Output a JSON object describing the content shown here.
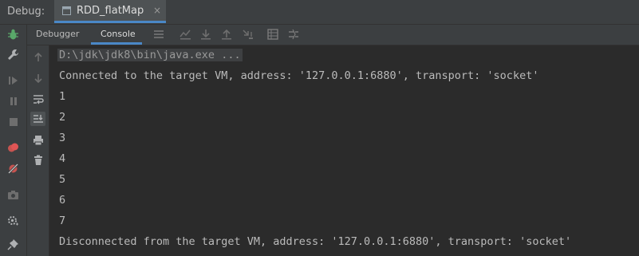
{
  "header": {
    "debug_label": "Debug:",
    "run_tab_label": "RDD_flatMap",
    "close_glyph": "×"
  },
  "toolbar": {
    "tabs": [
      "Debugger",
      "Console"
    ],
    "active_tab": "Console",
    "icons": [
      "menu-icon",
      "show-execution-point-icon",
      "step-over-icon",
      "step-into-icon",
      "step-out-icon",
      "run-to-cursor-icon",
      "evaluate-expression-icon",
      "trace-icon"
    ]
  },
  "left_toolbar": {
    "icons": [
      "debug-bug-icon",
      "wrench-icon",
      "resume-icon",
      "pause-icon",
      "stop-icon",
      "view-breakpoints-icon",
      "mute-breakpoints-icon",
      "camera-icon",
      "settings-icon",
      "pin-icon"
    ]
  },
  "console_sidebar": {
    "icons": [
      "up-arrow-icon",
      "down-arrow-icon",
      "soft-wrap-icon",
      "scroll-to-end-icon",
      "print-icon",
      "trash-icon"
    ]
  },
  "console": {
    "lines": [
      "D:\\jdk\\jdk8\\bin\\java.exe ...",
      "Connected to the target VM, address: '127.0.0.1:6880', transport: 'socket'",
      "1",
      "2",
      "3",
      "4",
      "5",
      "6",
      "7",
      "Disconnected from the target VM, address: '127.0.0.1:6880', transport: 'socket'"
    ]
  },
  "colors": {
    "background": "#2b2b2b",
    "panel": "#3c3f41",
    "accent": "#4a88c7",
    "text": "#bbbbbb"
  }
}
